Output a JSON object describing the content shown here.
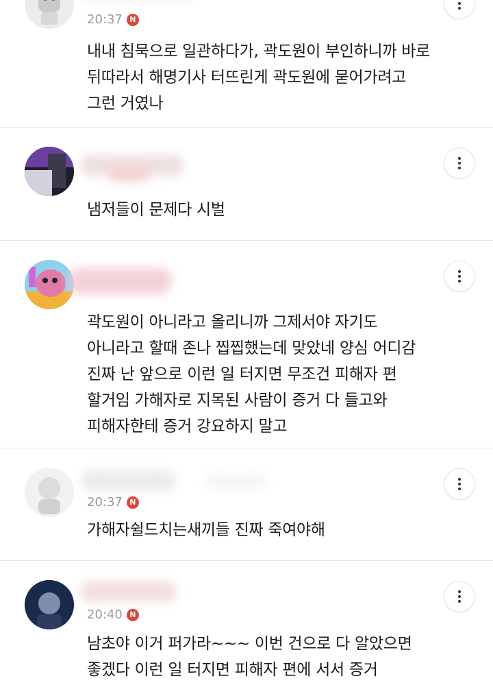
{
  "comments": [
    {
      "time": "20:37",
      "badge": "N",
      "text": "내내 침묵으로 일관하다가, 곽도원이 부인하니까 바로\n뒤따라서 해명기사 터뜨린게 곽도원에 묻어가려고\n그런 거였나"
    },
    {
      "time": "",
      "badge": "",
      "text": "냄저들이 문제다 시벌"
    },
    {
      "time": "",
      "badge": "",
      "text": "곽도원이 아니라고 올리니까 그제서야 자기도\n아니라고 할때 존나 찝찝했는데 맞았네 양심 어디감\n진짜 난 앞으로 이런 일 터지면 무조건 피해자 편\n할거임 가해자로 지목된 사람이 증거 다 들고와\n피해자한테 증거 강요하지 말고"
    },
    {
      "time": "20:37",
      "badge": "N",
      "text": "가해자쉴드치는새끼들 진짜 죽여야해"
    },
    {
      "time": "20:40",
      "badge": "N",
      "text": "남초야 이거 퍼가라~~~ 이번 건으로 다 알았으면\n좋겠다 이런 일 터지면 피해자 편에 서서 증거"
    }
  ],
  "colors": {
    "badge": "#e0463c",
    "divider": "#e6e6e6",
    "meta_text": "#9a9a9a"
  },
  "icons": {
    "more": "more-vertical-icon"
  }
}
